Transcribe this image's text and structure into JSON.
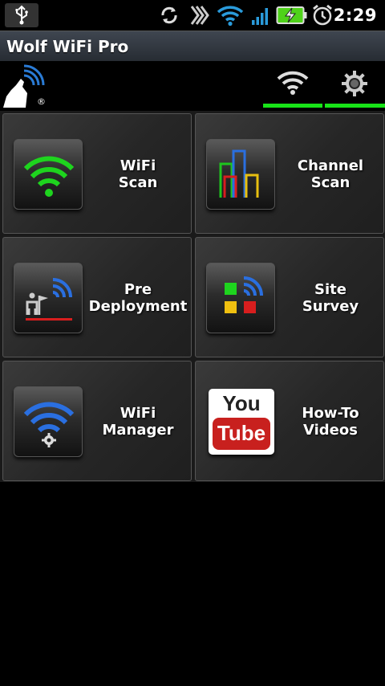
{
  "status_bar": {
    "time": "2:29",
    "icons": [
      "usb-icon",
      "sync-icon",
      "bluetooth-icon",
      "wifi-signal-icon",
      "cell-signal-icon",
      "battery-charging-icon",
      "alarm-icon"
    ],
    "signal_color": "#2a9bdb",
    "battery_color": "#4fd21a"
  },
  "app": {
    "title": "Wolf WiFi Pro",
    "logo_mark": "®"
  },
  "toolbar": {
    "tabs": [
      {
        "icon": "wifi-icon"
      },
      {
        "icon": "gear-icon"
      }
    ],
    "active_color": "#18e418"
  },
  "tiles": [
    {
      "line1": "WiFi",
      "line2": "Scan",
      "icon": "wifi-scan-icon"
    },
    {
      "line1": "Channel",
      "line2": "Scan",
      "icon": "channel-bars-icon"
    },
    {
      "line1": "Pre",
      "line2": "Deployment",
      "icon": "pre-deployment-icon"
    },
    {
      "line1": "Site",
      "line2": "Survey",
      "icon": "site-survey-icon"
    },
    {
      "line1": "WiFi",
      "line2": "Manager",
      "icon": "wifi-manager-icon"
    },
    {
      "line1": "How-To",
      "line2": "Videos",
      "icon": "youtube-icon"
    }
  ],
  "youtube": {
    "you": "You",
    "tube": "Tube"
  }
}
